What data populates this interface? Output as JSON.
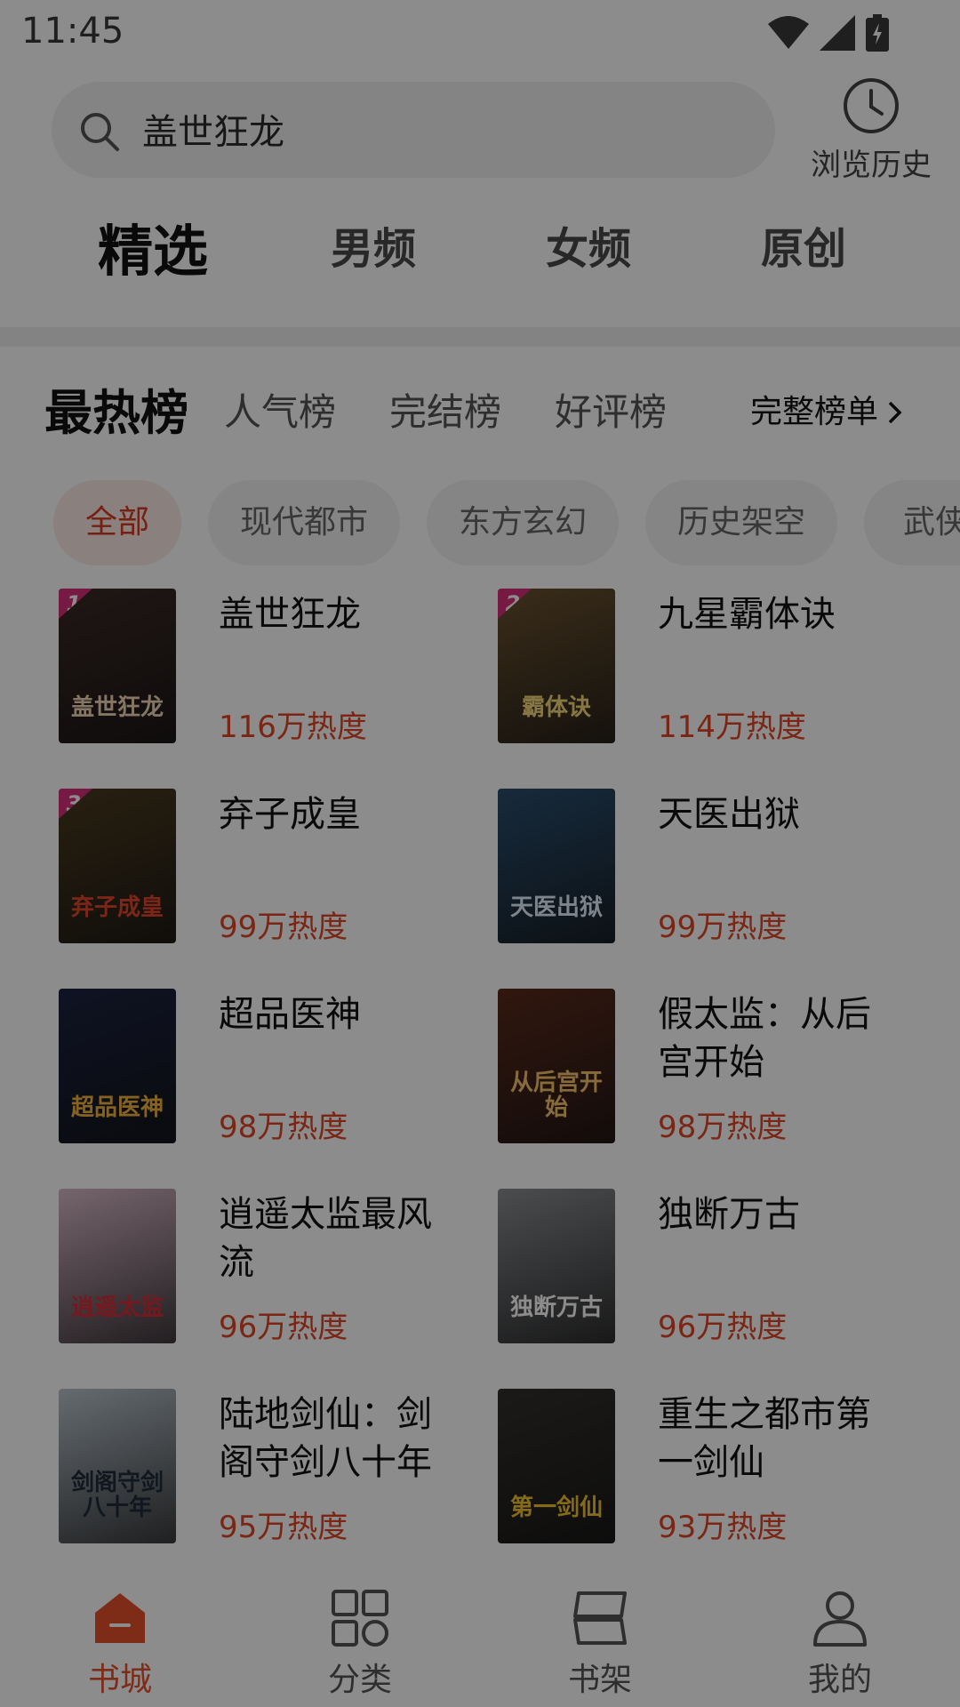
{
  "status": {
    "time": "11:45"
  },
  "search": {
    "query": "盖世狂龙",
    "history_label": "浏览历史"
  },
  "channels": [
    "精选",
    "男频",
    "女频",
    "原创"
  ],
  "rankings": {
    "main": "最热榜",
    "tabs": [
      "人气榜",
      "完结榜",
      "好评榜"
    ],
    "full_list": "完整榜单"
  },
  "categories": [
    "全部",
    "现代都市",
    "东方玄幻",
    "历史架空",
    "武侠"
  ],
  "books": [
    {
      "title": "盖世狂龙",
      "heat": "116万热度",
      "rank": "1",
      "cover_text": "盖世狂龙",
      "cover_bg": "#3b2a26",
      "cover_fg": "#f2d8b6"
    },
    {
      "title": "九星霸体诀",
      "heat": "114万热度",
      "rank": "2",
      "cover_text": "霸体诀",
      "cover_bg": "#6b5230",
      "cover_fg": "#f4d77a"
    },
    {
      "title": "弃子成皇",
      "heat": "99万热度",
      "rank": "3",
      "cover_text": "弃子成皇",
      "cover_bg": "#4a3a1f",
      "cover_fg": "#e0462b"
    },
    {
      "title": "天医出狱",
      "heat": "99万热度",
      "cover_text": "天医出狱",
      "cover_bg": "#2a4e6e",
      "cover_fg": "#e6f0ff"
    },
    {
      "title": "超品医神",
      "heat": "98万热度",
      "cover_text": "超品医神",
      "cover_bg": "#1b2340",
      "cover_fg": "#f3b33c"
    },
    {
      "title": "假太监：从后宫开始",
      "heat": "98万热度",
      "cover_text": "从后宫开始",
      "cover_bg": "#5a2a1c",
      "cover_fg": "#f6c46b"
    },
    {
      "title": "逍遥太监最风流",
      "heat": "96万热度",
      "cover_text": "逍遥太监",
      "cover_bg": "#d7b8c8",
      "cover_fg": "#d82e3a"
    },
    {
      "title": "独断万古",
      "heat": "96万热度",
      "cover_text": "独断万古",
      "cover_bg": "#8a8c90",
      "cover_fg": "#ffffff"
    },
    {
      "title": "陆地剑仙：剑阁守剑八十年",
      "heat": "95万热度",
      "cover_text": "剑阁守剑八十年",
      "cover_bg": "#b9c3cc",
      "cover_fg": "#1f2a38"
    },
    {
      "title": "重生之都市第一剑仙",
      "heat": "93万热度",
      "cover_text": "第一剑仙",
      "cover_bg": "#33302c",
      "cover_fg": "#f2c230"
    }
  ],
  "bottom_tabs": [
    {
      "label": "书城",
      "icon": "home-icon"
    },
    {
      "label": "分类",
      "icon": "category-grid-icon"
    },
    {
      "label": "书架",
      "icon": "bookshelf-icon"
    },
    {
      "label": "我的",
      "icon": "profile-icon"
    }
  ],
  "colors": {
    "accent": "#e6512d",
    "heat": "#e04526",
    "overlay": "rgba(0,0,0,0.45)"
  }
}
